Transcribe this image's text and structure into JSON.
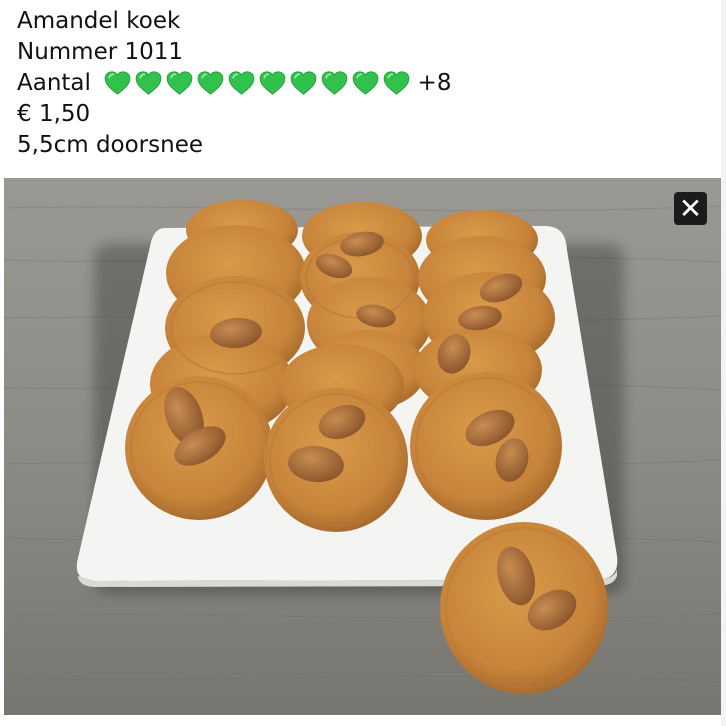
{
  "caption": {
    "title": "Amandel koek",
    "number_line": "Nummer 1011",
    "quantity_label": "Aantal",
    "quantity_heart_count": 10,
    "quantity_extra": "+8",
    "price": "€ 1,50",
    "size": "5,5cm doorsnee"
  },
  "icons": {
    "heart": "green-heart-icon",
    "close": "close-icon"
  },
  "colors": {
    "heart_green": "#31c24d",
    "close_bg": "#1b1b1b"
  },
  "close_button": {
    "symbol": "✕"
  }
}
